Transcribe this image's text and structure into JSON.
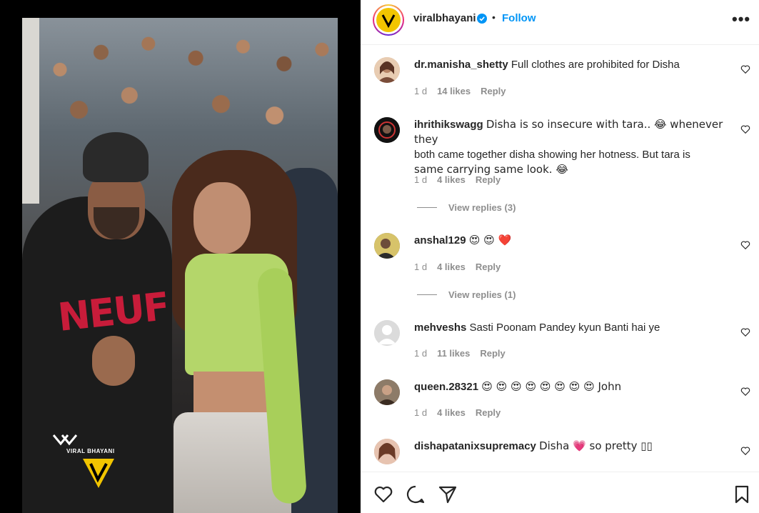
{
  "post": {
    "username": "viralbhayani",
    "follow_label": "Follow",
    "more_icon": "•••",
    "separator": "•",
    "media_watermark": "VIRAL BHAYANI",
    "media_shirt_text": "NEUF"
  },
  "comments": [
    {
      "user": "dr.manisha_shetty",
      "text": "Full clothes are prohibited for Disha",
      "time": "1 d",
      "likes": "14 likes",
      "reply": "Reply",
      "avatar_color": "#d9b08c"
    },
    {
      "user": "ihrithikswagg",
      "text_line1": "Disha is so insecure with tara.. 😂 whenever they",
      "text_line2": "both came together disha showing her hotness. But tara is",
      "text_line3": "same carrying same look. 😂",
      "time": "1 d",
      "likes": "4 likes",
      "reply": "Reply",
      "view_replies": "View replies (3)",
      "avatar_color": "#1a1a1a"
    },
    {
      "user": "anshal129",
      "text": "😍 😍 ❤️",
      "time": "1 d",
      "likes": "4 likes",
      "reply": "Reply",
      "view_replies": "View replies (1)",
      "avatar_color": "#6b6a48"
    },
    {
      "user": "mehveshs",
      "text": "Sasti Poonam Pandey kyun Banti hai ye",
      "time": "1 d",
      "likes": "11 likes",
      "reply": "Reply",
      "avatar_color": "#dbdbdb"
    },
    {
      "user": "queen.28321",
      "text": "😍 😍 😍 😍 😍 😍 😍 😍 John",
      "time": "1 d",
      "likes": "4 likes",
      "reply": "Reply",
      "avatar_color": "#7a6a5a"
    },
    {
      "user": "dishapatanixsupremacy",
      "text": "Disha 💗 so pretty ▯▯",
      "avatar_color": "#c9a38c"
    }
  ],
  "colors": {
    "accent": "#0095f6",
    "text": "#262626",
    "muted": "#8e8e8e",
    "heart": "#ed4956"
  },
  "icons": [
    "verified-icon",
    "heart-icon",
    "comment-icon",
    "share-icon",
    "bookmark-icon",
    "more-icon"
  ]
}
